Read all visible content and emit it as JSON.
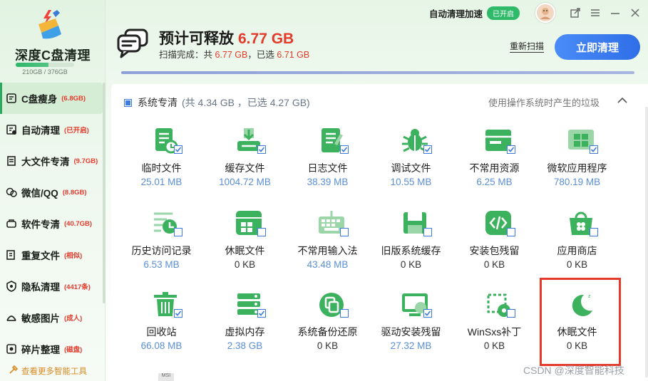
{
  "app": {
    "name": "深度C盘清理",
    "disk_usage": "210GB / 376GB",
    "disk_usage_fraction": 0.56
  },
  "colors": {
    "accent_green": "#2fb86a",
    "danger_red": "#e53a2a",
    "primary_blue": "#2f6ee8",
    "size_blue": "#5a8fd6"
  },
  "topbar": {
    "auto_clean_label": "自动清理加速",
    "auto_clean_status": "已开启"
  },
  "header": {
    "title": "预计可释放",
    "title_size": "6.77 GB",
    "scan_prefix": "扫描完成：共",
    "scan_total": "6.77 GB",
    "scan_mid": "，已选",
    "scan_selected": "6.71 GB",
    "rescan_label": "重新扫描",
    "clean_label": "立即清理",
    "scan_progress": 1.0
  },
  "sidebar": {
    "items": [
      {
        "label": "C盘瘦身",
        "badge": "(6.8GB)",
        "icon": "disk-icon",
        "active": true
      },
      {
        "label": "自动清理",
        "badge": "(已开启)",
        "icon": "auto-clean-icon"
      },
      {
        "label": "大文件专清",
        "badge": "(9.7GB)",
        "icon": "large-file-icon"
      },
      {
        "label": "微信/QQ",
        "badge": "(8.8GB)",
        "icon": "chat-icon"
      },
      {
        "label": "软件专清",
        "badge": "(40.7GB)",
        "icon": "software-icon"
      },
      {
        "label": "重复文件",
        "badge": "(相似)",
        "icon": "duplicate-icon"
      },
      {
        "label": "隐私清理",
        "badge": "(4417条)",
        "icon": "privacy-icon"
      },
      {
        "label": "敏感图片",
        "badge": "(成人)",
        "icon": "sensitive-image-icon"
      },
      {
        "label": "碎片整理",
        "badge": "(磁盘)",
        "icon": "defrag-icon"
      }
    ],
    "more_label": "查看更多智能工具"
  },
  "section": {
    "title": "系统专清",
    "stats": "(共 4.34 GB ，已选 4.27 GB)",
    "description": "使用操作系统时产生的垃圾"
  },
  "tiles": [
    {
      "name": "临时文件",
      "size": "25.01 MB",
      "icon": "temp-file-icon",
      "checked": true
    },
    {
      "name": "缓存文件",
      "size": "1004.72 MB",
      "icon": "cache-file-icon",
      "checked": true
    },
    {
      "name": "日志文件",
      "size": "38.39 MB",
      "icon": "log-file-icon",
      "checked": true
    },
    {
      "name": "调试文件",
      "size": "10.55 MB",
      "icon": "debug-file-icon",
      "checked": true
    },
    {
      "name": "不常用资源",
      "size": "6.25 MB",
      "icon": "unused-resource-icon",
      "checked": true
    },
    {
      "name": "微软应用程序",
      "size": "780.19 MB",
      "icon": "ms-app-icon",
      "checked": true
    },
    {
      "name": "历史访问记录",
      "size": "6.53 MB",
      "icon": "history-icon",
      "checked": false
    },
    {
      "name": "休眠文件",
      "size": "0 KB",
      "icon": "hibernate-file-icon",
      "checked": false
    },
    {
      "name": "不常用输入法",
      "size": "43.48 MB",
      "icon": "keyboard-icon",
      "checked": false
    },
    {
      "name": "旧版系统缓存",
      "size": "0 KB",
      "icon": "old-system-cache-icon",
      "checked": false
    },
    {
      "name": "安装包残留",
      "size": "0 KB",
      "icon": "installer-residue-icon",
      "checked": false
    },
    {
      "name": "应用商店",
      "size": "0 KB",
      "icon": "app-store-icon",
      "checked": false
    },
    {
      "name": "回收站",
      "size": "66.08 MB",
      "icon": "recycle-bin-icon",
      "checked": true
    },
    {
      "name": "虚拟内存",
      "size": "2.38 GB",
      "icon": "virtual-memory-icon",
      "checked": true
    },
    {
      "name": "系统备份还原",
      "size": "0 KB",
      "icon": "backup-restore-icon",
      "checked": false
    },
    {
      "name": "驱动安装残留",
      "size": "27.32 MB",
      "icon": "driver-residue-icon",
      "checked": true
    },
    {
      "name": "WinSxs补丁",
      "size": "0 KB",
      "icon": "winsxs-icon",
      "checked": false
    },
    {
      "name": "休眠文件",
      "size": "0 KB",
      "icon": "moon-icon",
      "checked": false
    }
  ],
  "watermark": "CSDN @深度智能科技"
}
